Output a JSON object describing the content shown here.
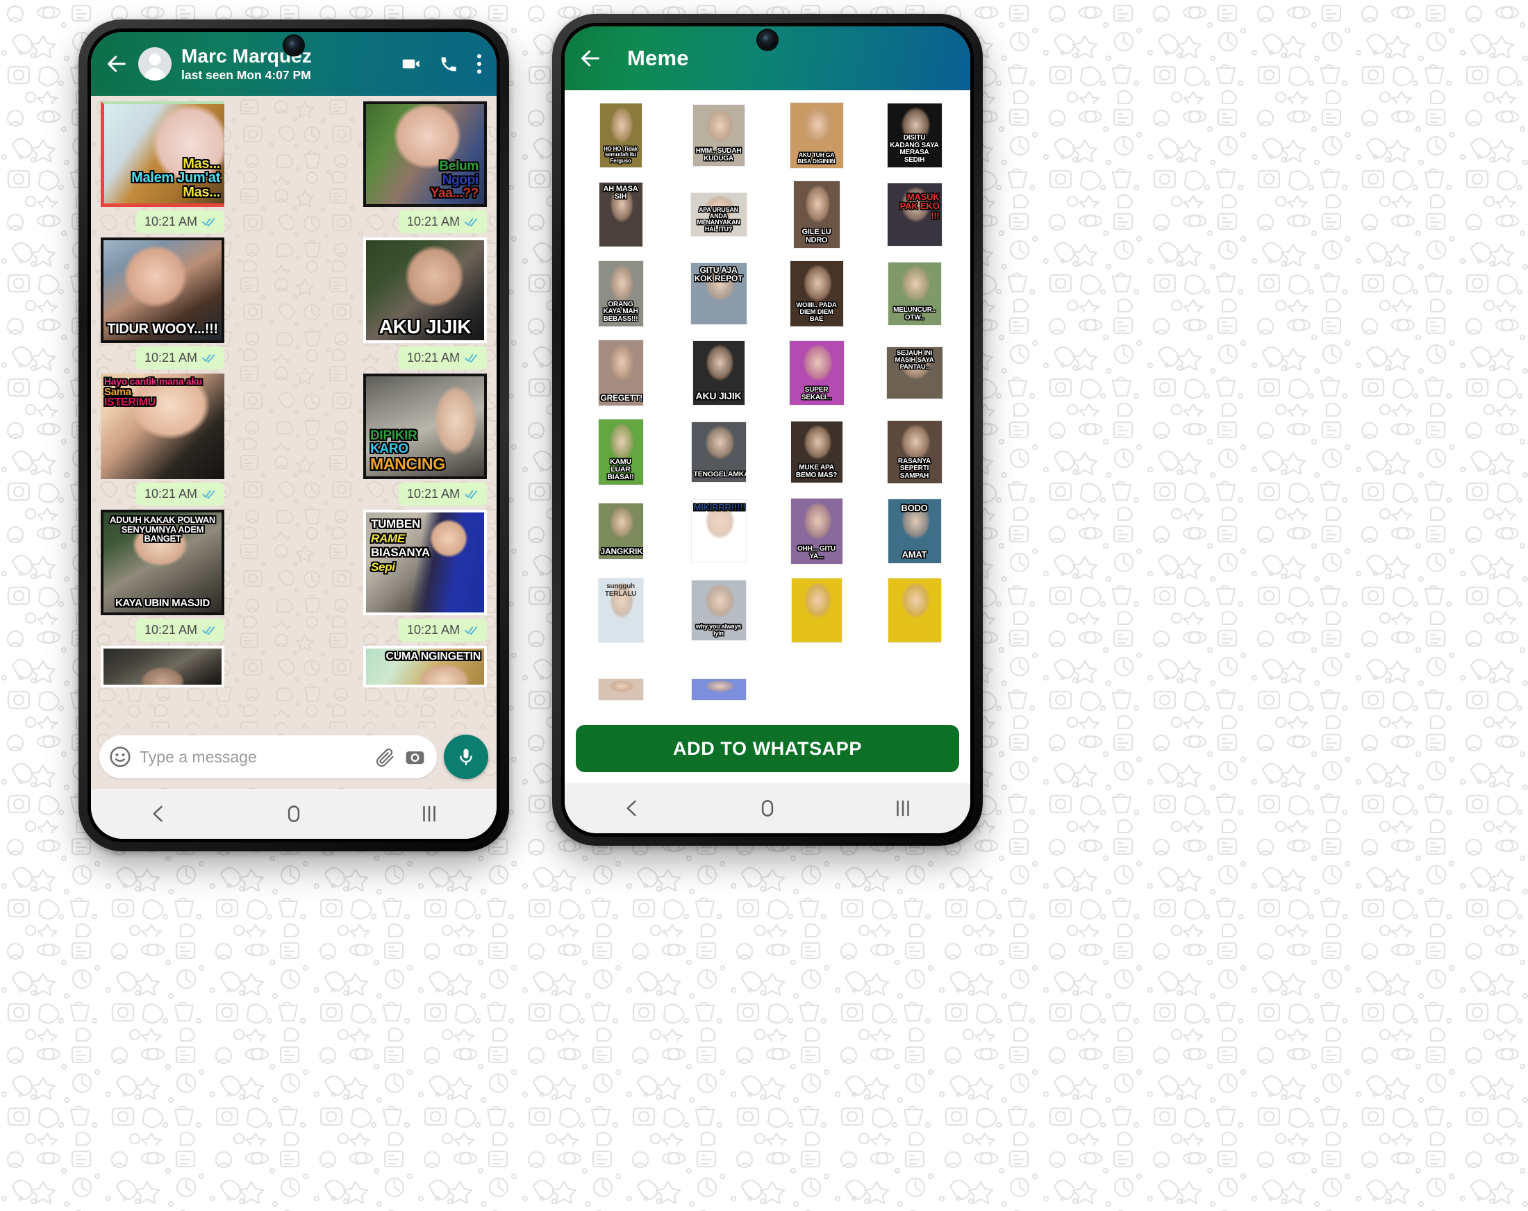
{
  "chat_phone": {
    "header": {
      "back_icon": "back-arrow-icon",
      "contact_name": "Marc Marquez",
      "contact_status": "last seen Mon 4:07 PM",
      "video_icon": "video-call-icon",
      "call_icon": "phone-call-icon",
      "menu_icon": "overflow-menu-icon"
    },
    "messages": [
      [
        {
          "caption_lines": [
            "Mas...",
            "Malem Jum'at",
            "Mas..."
          ],
          "caption_colors": [
            "#f5e23a",
            "#4de0ee",
            "#f5e23a"
          ],
          "time": "10:21 AM",
          "status": "delivered"
        },
        {
          "caption_lines": [
            "Belum",
            "Ngopi",
            "Yaa...??"
          ],
          "caption_colors": [
            "#2f9e3f",
            "#2b3fb8",
            "#c4352c"
          ],
          "time": "10:21 AM",
          "status": "delivered"
        }
      ],
      [
        {
          "caption_lines": [
            "TIDUR WOOY...!!!"
          ],
          "caption_colors": [
            "#ffffff"
          ],
          "time": "10:21 AM",
          "status": "delivered"
        },
        {
          "caption_lines": [
            "AKU JIJIK"
          ],
          "caption_colors": [
            "#ffffff"
          ],
          "time": "10:21 AM",
          "status": "delivered"
        }
      ],
      [
        {
          "caption_lines": [
            "Hayo cantik mana aku",
            "Sama",
            "ISTERIMU"
          ],
          "caption_colors": [
            "#e8307d",
            "#f0a92e",
            "#d8145a"
          ],
          "time": "10:21 AM",
          "status": "delivered"
        },
        {
          "caption_lines": [
            "DIPIKIR",
            "KARO",
            "MANCING"
          ],
          "caption_colors": [
            "#2f9e3f",
            "#35c9f0",
            "#f5a623"
          ],
          "time": "10:21 AM",
          "status": "delivered"
        }
      ],
      [
        {
          "caption_lines": [
            "ADUUH KAKAK POLWAN",
            "SENYUMNYA ADEM BANGET"
          ],
          "caption_bottom": [
            "KAYA UBIN MASJID"
          ],
          "caption_colors": [
            "#ffffff"
          ],
          "time": "10:21 AM",
          "status": "delivered"
        },
        {
          "caption_lines": [
            "TUMBEN",
            "RAME",
            "BIASANYA",
            "Sepi"
          ],
          "caption_colors": [
            "#ffffff",
            "#f3e83c",
            "#ffffff",
            "#f3e83c"
          ],
          "time": "10:21 AM",
          "status": "delivered"
        }
      ],
      [
        {
          "caption_lines": [],
          "caption_colors": [],
          "time": "",
          "status": ""
        },
        {
          "caption_lines": [
            "CUMA NGINGETIN"
          ],
          "caption_colors": [
            "#ffffff"
          ],
          "time": "",
          "status": ""
        }
      ]
    ],
    "composer": {
      "emoji_icon": "emoji-smiley-icon",
      "placeholder": "Type a message",
      "value": "",
      "attach_icon": "paperclip-icon",
      "camera_icon": "camera-icon",
      "mic_icon": "microphone-icon"
    },
    "navbar": {
      "back": "nav-back-icon",
      "home": "nav-home-icon",
      "recents": "nav-recents-icon"
    }
  },
  "pack_phone": {
    "header": {
      "back_icon": "back-arrow-icon",
      "title": "Meme"
    },
    "stickers": [
      {
        "caption": "HO HO. Tidak semudah itu Ferguso",
        "bg": "#8a7b3c",
        "w": 60,
        "h": 92,
        "pos": "bottom",
        "size": 8,
        "color": "#ffffff"
      },
      {
        "caption": "HMM.. SUDAH KUDUGA",
        "bg": "#b9b0a2",
        "w": 74,
        "h": 88,
        "pos": "bottom",
        "size": 10,
        "color": "#ffffff"
      },
      {
        "caption": "AKU TUH GA BISA DIGINIIN",
        "bg": "#c99a63",
        "w": 76,
        "h": 94,
        "pos": "bottom",
        "size": 8.5,
        "color": "#ffffff"
      },
      {
        "caption": "DISITU KADANG SAYA MERASA SEDIH",
        "bg": "#131313",
        "w": 78,
        "h": 92,
        "pos": "bottom",
        "size": 10,
        "color": "#ffffff"
      },
      {
        "caption": "AH MASA SIH",
        "bg": "#4c413c",
        "w": 62,
        "h": 92,
        "pos": "top",
        "size": 11,
        "color": "#ffffff"
      },
      {
        "caption": "APA URUSAN ANDA MENANYAKAN HAL ITU?",
        "bg": "#d6d2ca",
        "w": 80,
        "h": 62,
        "pos": "bottom",
        "size": 9,
        "color": "#ffffff"
      },
      {
        "caption": "GILE LU NDRO",
        "bg": "#6d5546",
        "w": 66,
        "h": 96,
        "pos": "bottom",
        "size": 11,
        "color": "#ffffff"
      },
      {
        "caption": "MASUK PAK EKO !!!",
        "bg": "#38353f",
        "w": 78,
        "h": 90,
        "pos": "right",
        "size": 13,
        "color": "#e4342d"
      },
      {
        "caption": "ORANG KAYA MAH BEBASS!!!",
        "bg": "#8d8e86",
        "w": 64,
        "h": 94,
        "pos": "bottom",
        "size": 10,
        "color": "#ffffff"
      },
      {
        "caption": "GITU AJA KOK REPOT",
        "bg": "#8c9caa",
        "w": 80,
        "h": 88,
        "pos": "top",
        "size": 12,
        "color": "#ffffff"
      },
      {
        "caption": "WOIIII.. PADA DIEM DIEM BAE",
        "bg": "#473429",
        "w": 76,
        "h": 94,
        "pos": "bottom",
        "size": 9.5,
        "color": "#ffffff"
      },
      {
        "caption": "MELUNCUR.. OTW..",
        "bg": "#7f9a68",
        "w": 76,
        "h": 90,
        "pos": "bottom",
        "size": 10,
        "color": "#ffffff"
      },
      {
        "caption": "GREGETT!!",
        "bg": "#a48d80",
        "w": 64,
        "h": 94,
        "pos": "bottom",
        "size": 12,
        "color": "#ffffff"
      },
      {
        "caption": "AKU JIJIK",
        "bg": "#2b2b2b",
        "w": 74,
        "h": 92,
        "pos": "bottom",
        "size": 14,
        "color": "#ffffff"
      },
      {
        "caption": "SUPER SEKALI...",
        "bg": "#b44bb0",
        "w": 78,
        "h": 92,
        "pos": "bottom",
        "size": 10,
        "color": "#ffffff"
      },
      {
        "caption": "SEJAUH INI MASIH SAYA PANTAU..",
        "bg": "#6d6154",
        "w": 80,
        "h": 74,
        "pos": "top",
        "size": 9.5,
        "color": "#ffffff"
      },
      {
        "caption": "KAMU LUAR BIASA!!",
        "bg": "#63a642",
        "w": 64,
        "h": 94,
        "pos": "bottom",
        "size": 10.5,
        "color": "#ffffff"
      },
      {
        "caption": "TENGGELAMKAN",
        "bg": "#54585c",
        "w": 78,
        "h": 86,
        "pos": "bottom",
        "size": 10.5,
        "color": "#ffffff"
      },
      {
        "caption": "MUKE APA BEMO MAS?",
        "bg": "#3e3129",
        "w": 74,
        "h": 88,
        "pos": "bottom",
        "size": 10,
        "color": "#ffffff"
      },
      {
        "caption": "RASANYA SEPERTI SAMPAH",
        "bg": "#5c4a3f",
        "w": 78,
        "h": 90,
        "pos": "bottom",
        "size": 10,
        "color": "#ffffff"
      },
      {
        "caption": "JANGKRIK",
        "bg": "#7c8a5c",
        "w": 64,
        "h": 80,
        "pos": "bottom",
        "size": 12,
        "color": "#ffffff"
      },
      {
        "caption": "MIKIRRR!!!!!",
        "bg": "#ffffff",
        "w": 78,
        "h": 90,
        "pos": "top",
        "size": 13,
        "color": "#2a4a8a"
      },
      {
        "caption": "OHH... GITU YA...",
        "bg": "#8a6a9c",
        "w": 74,
        "h": 94,
        "pos": "bottom",
        "size": 10,
        "color": "#ffffff"
      },
      {
        "caption": "BODO AMAT",
        "bg": "#3f6e88",
        "w": 76,
        "h": 92,
        "pos": "split",
        "size": 13,
        "color": "#ffffff"
      },
      {
        "caption": "sungguh TERLALU",
        "bg": "#d8e3ea",
        "w": 64,
        "h": 92,
        "pos": "none",
        "size": 10,
        "color": "#3a3228"
      },
      {
        "caption": "why you always lyin",
        "bg": "#b6bcc2",
        "w": 78,
        "h": 86,
        "pos": "bottom",
        "size": 9,
        "color": "#ffffff"
      },
      {
        "caption": "",
        "bg": "#e5c21a",
        "w": 72,
        "h": 92,
        "pos": "none",
        "size": 10,
        "color": "#ffffff"
      },
      {
        "caption": "",
        "bg": "#e5c21a",
        "w": 76,
        "h": 92,
        "pos": "none",
        "size": 10,
        "color": "#ffffff"
      },
      {
        "caption": "",
        "bg": "#d9c3b4",
        "w": 64,
        "h": 30,
        "pos": "none",
        "size": 10,
        "color": "#ffffff"
      },
      {
        "caption": "",
        "bg": "#7b8fdc",
        "w": 78,
        "h": 30,
        "pos": "none",
        "size": 10,
        "color": "#ffffff"
      },
      {
        "caption": "",
        "bg": "transparent",
        "w": 0,
        "h": 0,
        "pos": "none",
        "size": 10,
        "color": "#ffffff"
      },
      {
        "caption": "",
        "bg": "transparent",
        "w": 0,
        "h": 0,
        "pos": "none",
        "size": 10,
        "color": "#ffffff"
      }
    ],
    "add_button_label": "ADD TO WHATSAPP",
    "navbar": {
      "back": "nav-back-icon",
      "home": "nav-home-icon",
      "recents": "nav-recents-icon"
    }
  },
  "theme": {
    "appbar_green": "#0d7a4c",
    "appbar_blue": "#0a5f93",
    "bubble_green": "#dcf8c6",
    "tick_blue": "#34b7f1",
    "add_button_green": "#0c7026",
    "chat_bg": "#ebe3db"
  }
}
